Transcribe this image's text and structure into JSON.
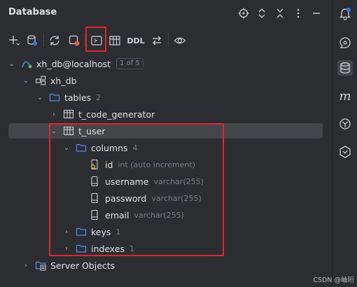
{
  "panel": {
    "title": "Database"
  },
  "toolbar": {
    "items": [
      "add-icon",
      "data-source-properties-icon",
      "refresh-icon",
      "stop-icon",
      "query-console-icon",
      "table-editor-icon",
      "DDL",
      "jump-to-source-icon",
      "view-options-icon"
    ],
    "ddl_label": "DDL"
  },
  "tree": {
    "connection": {
      "label": "xh_db@localhost",
      "badge": "1 of 5"
    },
    "schema": {
      "label": "xh_db"
    },
    "tables": {
      "label": "tables",
      "count": "2"
    },
    "table1": {
      "label": "t_code_generator"
    },
    "table2": {
      "label": "t_user"
    },
    "columns": {
      "label": "columns",
      "count": "4"
    },
    "col_id": {
      "label": "id",
      "type": "int (auto increment)"
    },
    "col_username": {
      "label": "username",
      "type": "varchar(255)"
    },
    "col_password": {
      "label": "password",
      "type": "varchar(255)"
    },
    "col_email": {
      "label": "email",
      "type": "varchar(255)"
    },
    "keys": {
      "label": "keys",
      "count": "1"
    },
    "indexes": {
      "label": "indexes",
      "count": "1"
    },
    "server_objects": {
      "label": "Server Objects"
    }
  },
  "watermark": "CSDN @岫珩",
  "colors": {
    "accent": "#3574f0",
    "highlight": "#e0262b",
    "background": "#2b2d30",
    "selection": "#43454a"
  }
}
